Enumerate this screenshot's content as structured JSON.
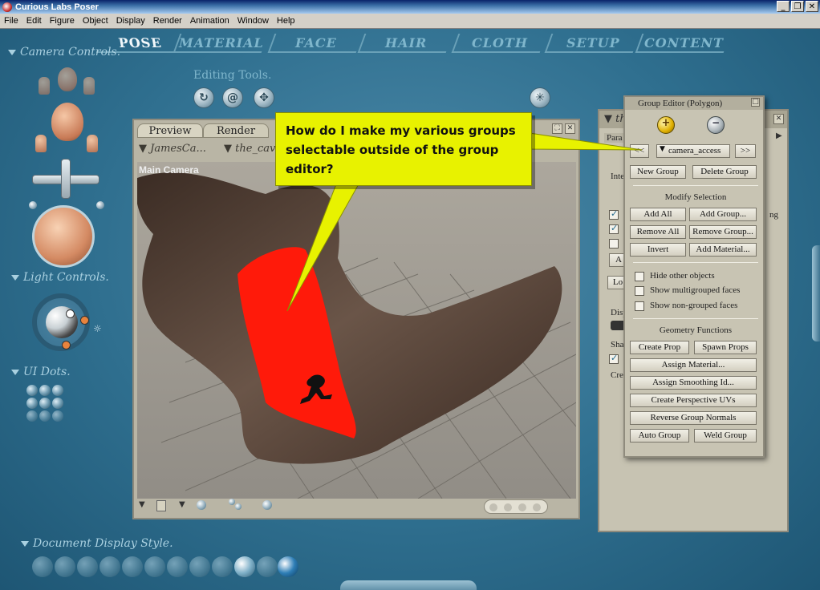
{
  "window": {
    "title": "Curious Labs Poser"
  },
  "menubar": [
    "File",
    "Edit",
    "Figure",
    "Object",
    "Display",
    "Render",
    "Animation",
    "Window",
    "Help"
  ],
  "rooms": [
    "POSE",
    "MATERIAL",
    "FACE",
    "HAIR",
    "CLOTH",
    "SETUP",
    "CONTENT"
  ],
  "active_room": "POSE",
  "sidebar": {
    "camera_controls": "Camera Controls.",
    "light_controls": "Light Controls.",
    "ui_dots": "UI Dots.",
    "document_display_style": "Document Display Style."
  },
  "editing_tools": {
    "label": "Editing Tools."
  },
  "document": {
    "tab_preview": "Preview",
    "tab_render": "Render",
    "figure_menu": "JamesCa...",
    "actor_menu": "the_caveu",
    "camera_label": "Main Camera"
  },
  "params_panel": {
    "header": "th",
    "tab": "Para",
    "labels": [
      "Inte",
      "A",
      "Lo",
      "Disp",
      "Shad",
      "Cre",
      "ng"
    ]
  },
  "group_editor": {
    "title": "Group Editor  (Polygon)",
    "prev": "<<",
    "next": ">>",
    "group_select": "camera_access",
    "new_group": "New Group",
    "delete_group": "Delete Group",
    "modify_selection": "Modify Selection",
    "add_all": "Add All",
    "add_group": "Add Group...",
    "remove_all": "Remove All",
    "remove_group": "Remove Group...",
    "invert": "Invert",
    "add_material": "Add Material...",
    "hide_other": "Hide other objects",
    "show_multigrouped": "Show multigrouped faces",
    "show_nongrouped": "Show non-grouped faces",
    "geometry_functions": "Geometry Functions",
    "create_prop": "Create Prop",
    "spawn_props": "Spawn Props",
    "assign_material": "Assign Material...",
    "assign_smoothing": "Assign Smoothing Id...",
    "create_perspective_uvs": "Create Perspective UVs",
    "reverse_group_normals": "Reverse Group Normals",
    "auto_group": "Auto Group",
    "weld_group": "Weld Group"
  },
  "callout": {
    "text": "How do I make my various groups selectable outside of the group editor?"
  },
  "colors": {
    "background": "#2e6f8e",
    "callout": "#e8f200",
    "selection_red": "#ff1a0a",
    "mesh_brown": "#4a3a30"
  }
}
